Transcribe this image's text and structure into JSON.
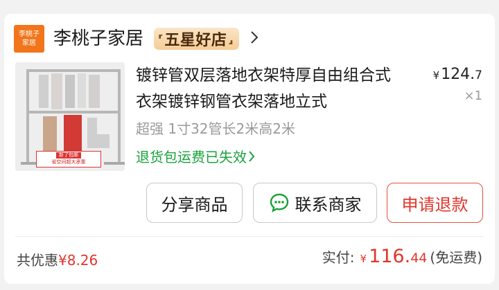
{
  "shop": {
    "logo_line1": "李桃子",
    "logo_line2": "家居",
    "name": "李桃子家居",
    "badge": "五星好店"
  },
  "product": {
    "title": "镀锌管双层落地衣架特厚自由组合式衣架镀锌钢管衣架落地立式",
    "price_currency": "¥",
    "price_int": "124.",
    "price_dec": "7",
    "quantity": "×1",
    "spec": "超强  1寸32管长2米高2米",
    "refund_note": "退货包运费已失效",
    "thumb_tag_top": "新了包邮",
    "thumb_tag_bottom": "省空间超大承重"
  },
  "actions": {
    "share": "分享商品",
    "contact": "联系商家",
    "refund": "申请退款"
  },
  "summary": {
    "discount_label": "共优惠",
    "discount_amount": "¥8.26",
    "paid_label": "实付:",
    "paid_currency": "¥",
    "paid_int": "116.",
    "paid_dec": "44",
    "shipping_note": "(免运费)"
  },
  "colors": {
    "accent_red": "#e0352a",
    "green": "#18a23c",
    "logo_orange": "#f2751b"
  }
}
